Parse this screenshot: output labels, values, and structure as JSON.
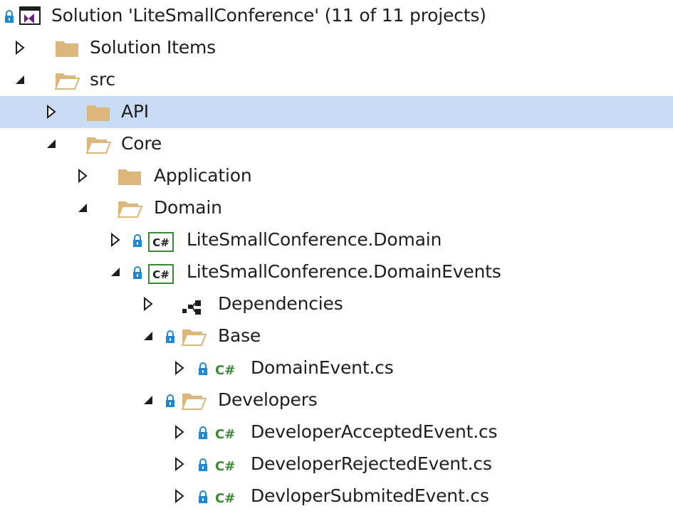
{
  "tree": {
    "solution_label": "Solution 'LiteSmallConference' (11 of 11 projects)",
    "nodes": [
      {
        "label": "Solution Items"
      },
      {
        "label": "src"
      },
      {
        "label": "API"
      },
      {
        "label": "Core"
      },
      {
        "label": "Application"
      },
      {
        "label": "Domain"
      },
      {
        "label": "LiteSmallConference.Domain"
      },
      {
        "label": "LiteSmallConference.DomainEvents"
      },
      {
        "label": "Dependencies"
      },
      {
        "label": "Base"
      },
      {
        "label": "DomainEvent.cs"
      },
      {
        "label": "Developers"
      },
      {
        "label": "DeveloperAcceptedEvent.cs"
      },
      {
        "label": "DeveloperRejectedEvent.cs"
      },
      {
        "label": "DevloperSubmitedEvent.cs"
      }
    ]
  },
  "colors": {
    "selection": "#c9dcf5",
    "folder": "#dcb67a",
    "lock": "#1e88d6",
    "csharp": "#388a34",
    "vs_purple": "#68217a"
  },
  "icons": {
    "solution": "visual-studio-solution-icon",
    "folder_closed": "folder-closed-icon",
    "folder_open": "folder-open-icon",
    "csproj": "csharp-project-icon",
    "csfile": "csharp-file-icon",
    "dependencies": "dependencies-icon",
    "lock": "lock-icon"
  }
}
